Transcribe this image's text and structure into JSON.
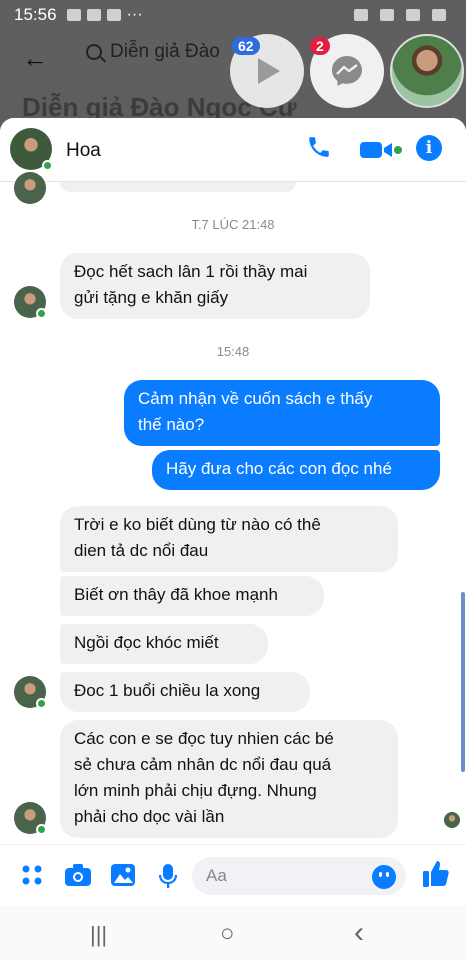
{
  "status_bar": {
    "time": "15:56",
    "more": "···"
  },
  "fb_header": {
    "search_text": "Diễn giả Đào",
    "back_glyph": "←",
    "title_peek": "Diễn giả Đào Ngọc Cư"
  },
  "chat_heads": {
    "video_badge": "62",
    "messenger_badge": "2"
  },
  "chat": {
    "contact_name": "Hoa",
    "timestamps": [
      "T.7 LÚC 21:48",
      "15:48"
    ],
    "messages": [
      {
        "side": "incoming",
        "text": "Đọc hết  sach lân 1 rồi  thầy  mai\ngửi tặng  e khăn  giấy"
      },
      {
        "side": "outgoing",
        "text": "Cảm nhận về cuốn sách e thấy\nthế nào?"
      },
      {
        "side": "outgoing",
        "text": "Hãy đưa cho các con đọc nhé"
      },
      {
        "side": "incoming",
        "text": "Trời e ko biết  dùng  từ  nào  có thê\ndien  tả dc nổi đau"
      },
      {
        "side": "incoming",
        "text": "Biết  ơn thây đã khoe mạnh"
      },
      {
        "side": "incoming",
        "text": "Ngồi  đọc  khóc miết"
      },
      {
        "side": "incoming",
        "text": "Đoc 1 buổi  chiều  la xong"
      },
      {
        "side": "incoming",
        "text": "Các con e se đọc  tuy nhien các bé\nsẻ  chưa  cảm nhân dc nổi  đau quá\nlớn  minh phải  chịu  đựng. Nhung\nphải  cho dọc vài lần"
      }
    ]
  },
  "composer": {
    "placeholder": "Aa"
  },
  "nav_bar": {
    "recents": "|||",
    "home": "○",
    "back": "‹"
  },
  "colors": {
    "messenger_blue": "#0a7cff",
    "incoming_bubble": "#f0f0f0",
    "online_green": "#31a24c"
  }
}
